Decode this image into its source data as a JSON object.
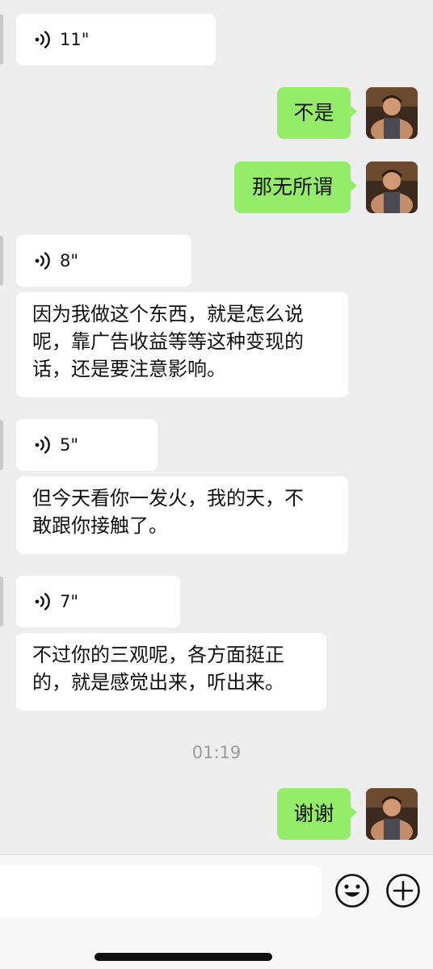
{
  "messages": [
    {
      "id": "m1",
      "side": "incoming",
      "kind": "voice",
      "duration": "11\""
    },
    {
      "id": "m2",
      "side": "outgoing",
      "kind": "text",
      "text": "不是"
    },
    {
      "id": "m3",
      "side": "outgoing",
      "kind": "text",
      "text": "那无所谓"
    },
    {
      "id": "m4",
      "side": "incoming",
      "kind": "voice",
      "duration": "8\""
    },
    {
      "id": "m5",
      "side": "incoming",
      "kind": "text",
      "lines": [
        "因为我做这个东西，就是怎么说",
        "呢，靠广告收益等等这种变现的",
        "话，还是要注意影响。"
      ]
    },
    {
      "id": "m6",
      "side": "incoming",
      "kind": "voice",
      "duration": "5\""
    },
    {
      "id": "m7",
      "side": "incoming",
      "kind": "text",
      "lines": [
        "但今天看你一发火，我的天，不",
        "敢跟你接触了。"
      ]
    },
    {
      "id": "m8",
      "side": "incoming",
      "kind": "voice",
      "duration": "7\""
    },
    {
      "id": "m9",
      "side": "incoming",
      "kind": "text",
      "lines": [
        "不过你的三观呢，各方面挺正",
        "的，就是感觉出来，听出来。"
      ]
    },
    {
      "id": "m10",
      "side": "outgoing",
      "kind": "text",
      "text": "谢谢"
    }
  ],
  "timestamp": "01:19",
  "input_bar": {
    "input_value": "",
    "emoji_icon": "emoji-icon",
    "plus_icon": "plus-icon"
  },
  "colors": {
    "background": "#ededed",
    "incoming_bubble": "#ffffff",
    "outgoing_bubble": "#95ec69",
    "timestamp_text": "#9b9b9b"
  }
}
